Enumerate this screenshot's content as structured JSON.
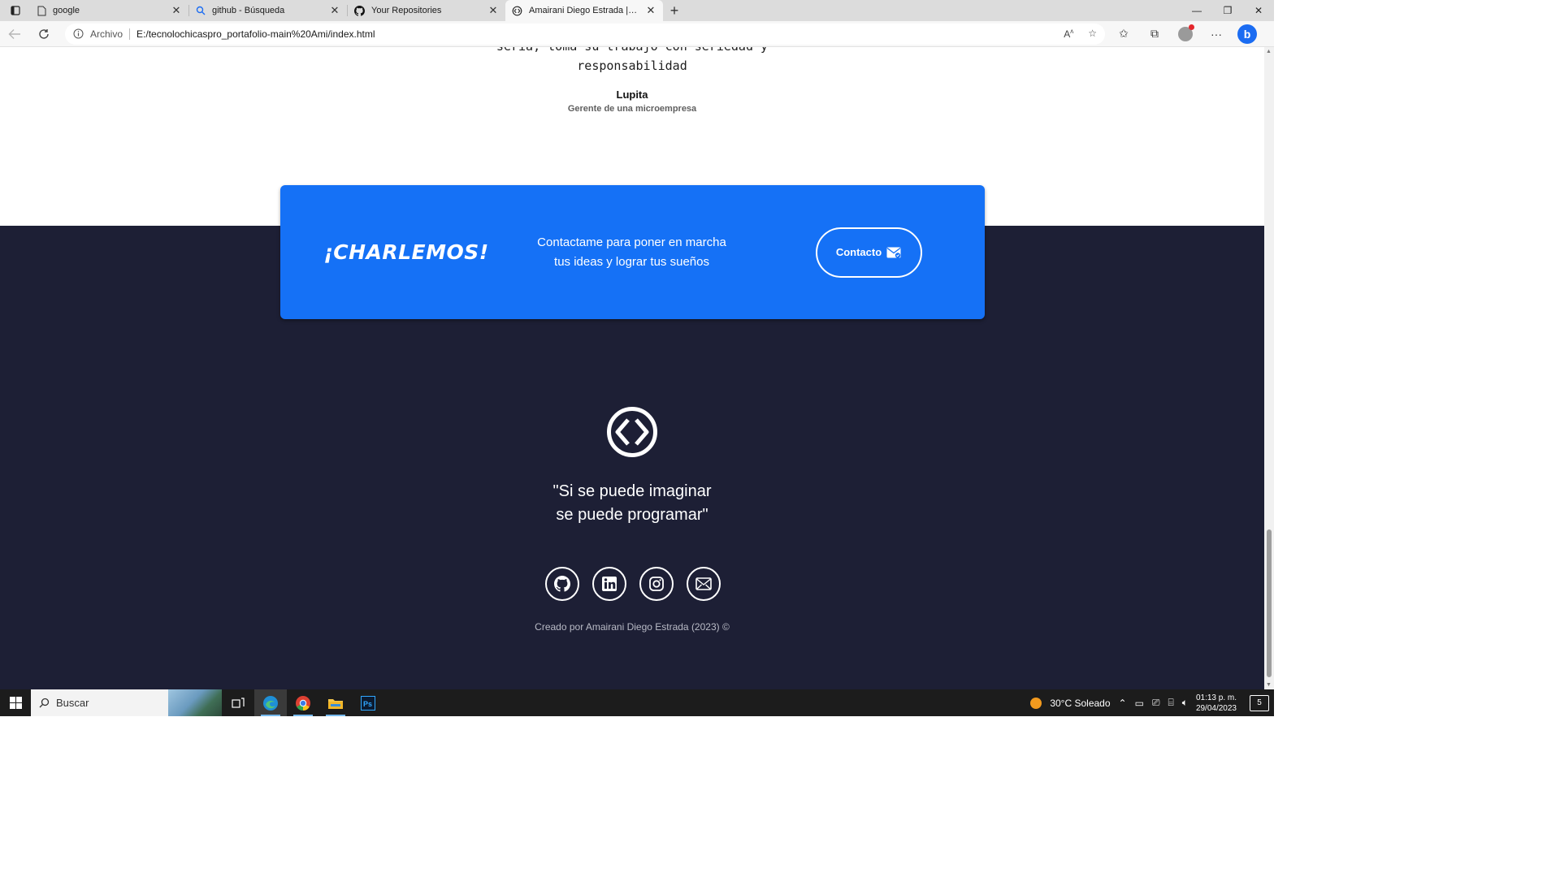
{
  "browser": {
    "tabs": [
      {
        "label": "google",
        "icon": "page-icon"
      },
      {
        "label": "github - Búsqueda",
        "icon": "search-icon"
      },
      {
        "label": "Your Repositories",
        "icon": "github-icon"
      },
      {
        "label": "Amairani Diego Estrada | Desarrolladora",
        "icon": "code-icon",
        "active": true
      }
    ],
    "address": {
      "scheme_label": "Archivo",
      "url": "E:/tecnolochicaspro_portafolio-main%20Ami/index.html"
    }
  },
  "testimonial": {
    "quote_line_1": "seria, toma su trabajo con seriedad y",
    "quote_line_2": "responsabilidad",
    "name": "Lupita",
    "role": "Gerente de una microempresa"
  },
  "cta": {
    "title": "¡CHARLEMOS!",
    "text": "Contactame para poner en marcha tus ideas y lograr tus sueños",
    "button_label": "Contacto",
    "background": "#1571f6"
  },
  "footer": {
    "quote_line_1": "\"Si se puede imaginar",
    "quote_line_2": "se puede programar\"",
    "socials": [
      "github-icon",
      "linkedin-icon",
      "instagram-icon",
      "email-icon"
    ],
    "credits": "Creado por Amairani Diego Estrada (2023) ©",
    "background": "#1d1f35"
  },
  "taskbar": {
    "search_placeholder": "Buscar",
    "weather": "30°C  Soleado",
    "time": "01:13 p. m.",
    "date": "29/04/2023",
    "notifications": "5"
  }
}
